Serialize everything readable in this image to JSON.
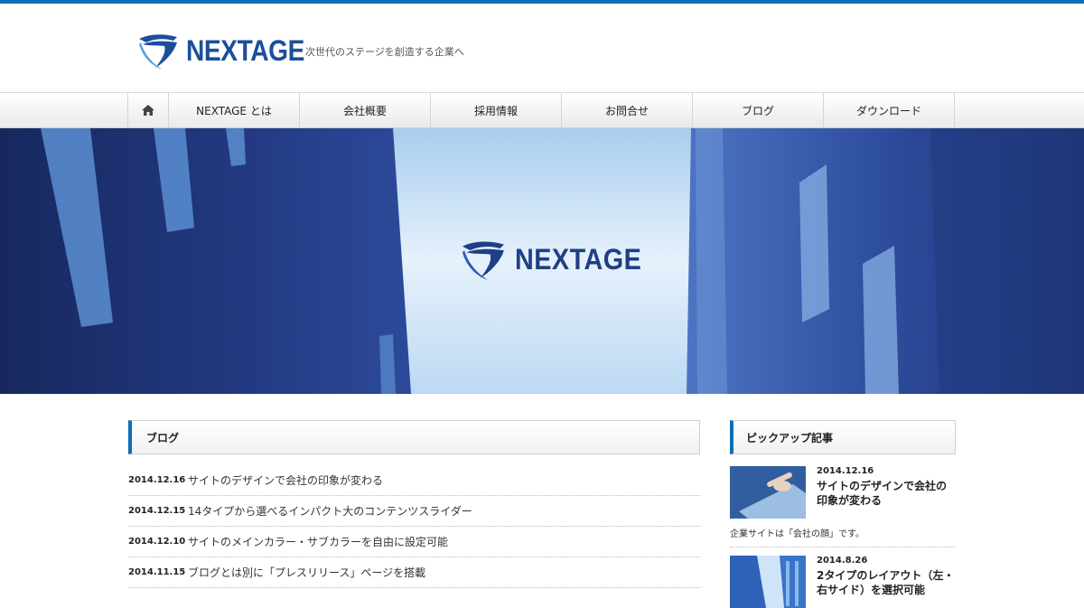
{
  "header": {
    "logo_text": "NEXTAGE",
    "tagline": "次世代のステージを創造する企業へ"
  },
  "nav": {
    "home_icon": "home-icon",
    "items": [
      {
        "label": "NEXTAGE とは"
      },
      {
        "label": "会社概要"
      },
      {
        "label": "採用情報"
      },
      {
        "label": "お問合せ"
      },
      {
        "label": "ブログ"
      },
      {
        "label": "ダウンロード"
      }
    ]
  },
  "hero": {
    "logo_text": "NEXTAGE"
  },
  "blog": {
    "heading": "ブログ",
    "posts": [
      {
        "date": "2014.12.16",
        "title": "サイトのデザインで会社の印象が変わる"
      },
      {
        "date": "2014.12.15",
        "title": "14タイプから選べるインパクト大のコンテンツスライダー"
      },
      {
        "date": "2014.12.10",
        "title": "サイトのメインカラー・サブカラーを自由に設定可能"
      },
      {
        "date": "2014.11.15",
        "title": "ブログとは別に「プレスリリース」ページを搭載"
      }
    ]
  },
  "pickup": {
    "heading": "ピックアップ記事",
    "posts": [
      {
        "date": "2014.12.16",
        "title": "サイトのデザインで会社の印象が変わる",
        "excerpt": "企業サイトは「会社の顔」です。"
      },
      {
        "date": "2014.8.26",
        "title": "2タイプのレイアウト（左・右サイド）を選択可能"
      }
    ]
  },
  "colors": {
    "accent": "#0c6fb3",
    "logo": "#1b4f9b"
  }
}
